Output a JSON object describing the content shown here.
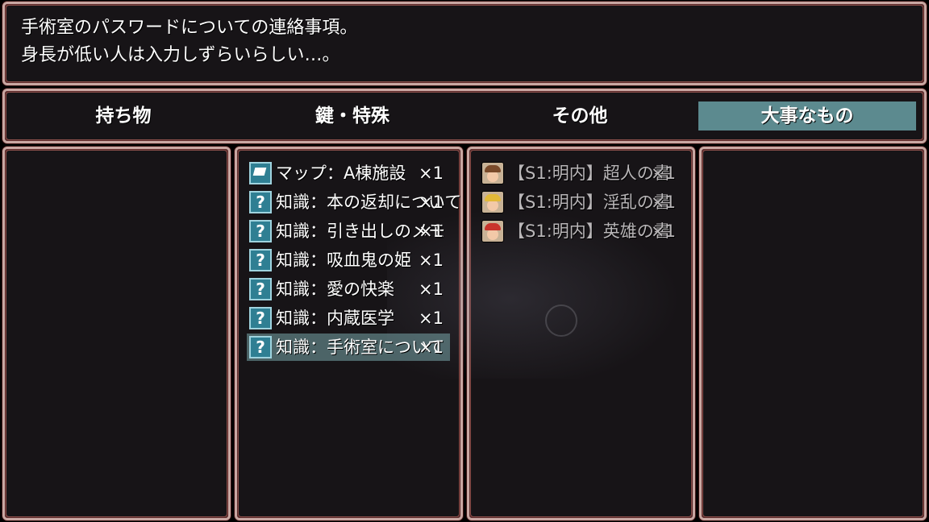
{
  "help": {
    "line1": "手術室のパスワードについての連絡事項。",
    "line2": "身長が低い人は入力しずらいらしい…。"
  },
  "categories": [
    {
      "label": "持ち物",
      "selected": false
    },
    {
      "label": "鍵・特殊",
      "selected": false
    },
    {
      "label": "その他",
      "selected": false
    },
    {
      "label": "大事なもの",
      "selected": true
    }
  ],
  "key_items": [
    {
      "name": "マップ：A棟施設",
      "qty": "×1",
      "icon": "map-icon"
    },
    {
      "name": "知識：本の返却について",
      "qty": "×1",
      "icon": "question-icon"
    },
    {
      "name": "知識：引き出しのメモ",
      "qty": "×1",
      "icon": "question-icon"
    },
    {
      "name": "知識：吸血鬼の姫",
      "qty": "×1",
      "icon": "question-icon"
    },
    {
      "name": "知識：愛の快楽",
      "qty": "×1",
      "icon": "question-icon"
    },
    {
      "name": "知識：内蔵医学",
      "qty": "×1",
      "icon": "question-icon"
    },
    {
      "name": "知識：手術室について",
      "qty": "×1",
      "icon": "question-icon",
      "selected": true
    }
  ],
  "books": [
    {
      "name": "【S1:明内】超人の書",
      "qty": "×1",
      "icon": "face-brown-icon",
      "hair": "#7a4a2a"
    },
    {
      "name": "【S1:明内】淫乱の書",
      "qty": "×1",
      "icon": "face-blonde-icon",
      "hair": "#e2b938"
    },
    {
      "name": "【S1:明内】英雄の書",
      "qty": "×1",
      "icon": "face-red-icon",
      "hair": "#c8342c"
    }
  ]
}
